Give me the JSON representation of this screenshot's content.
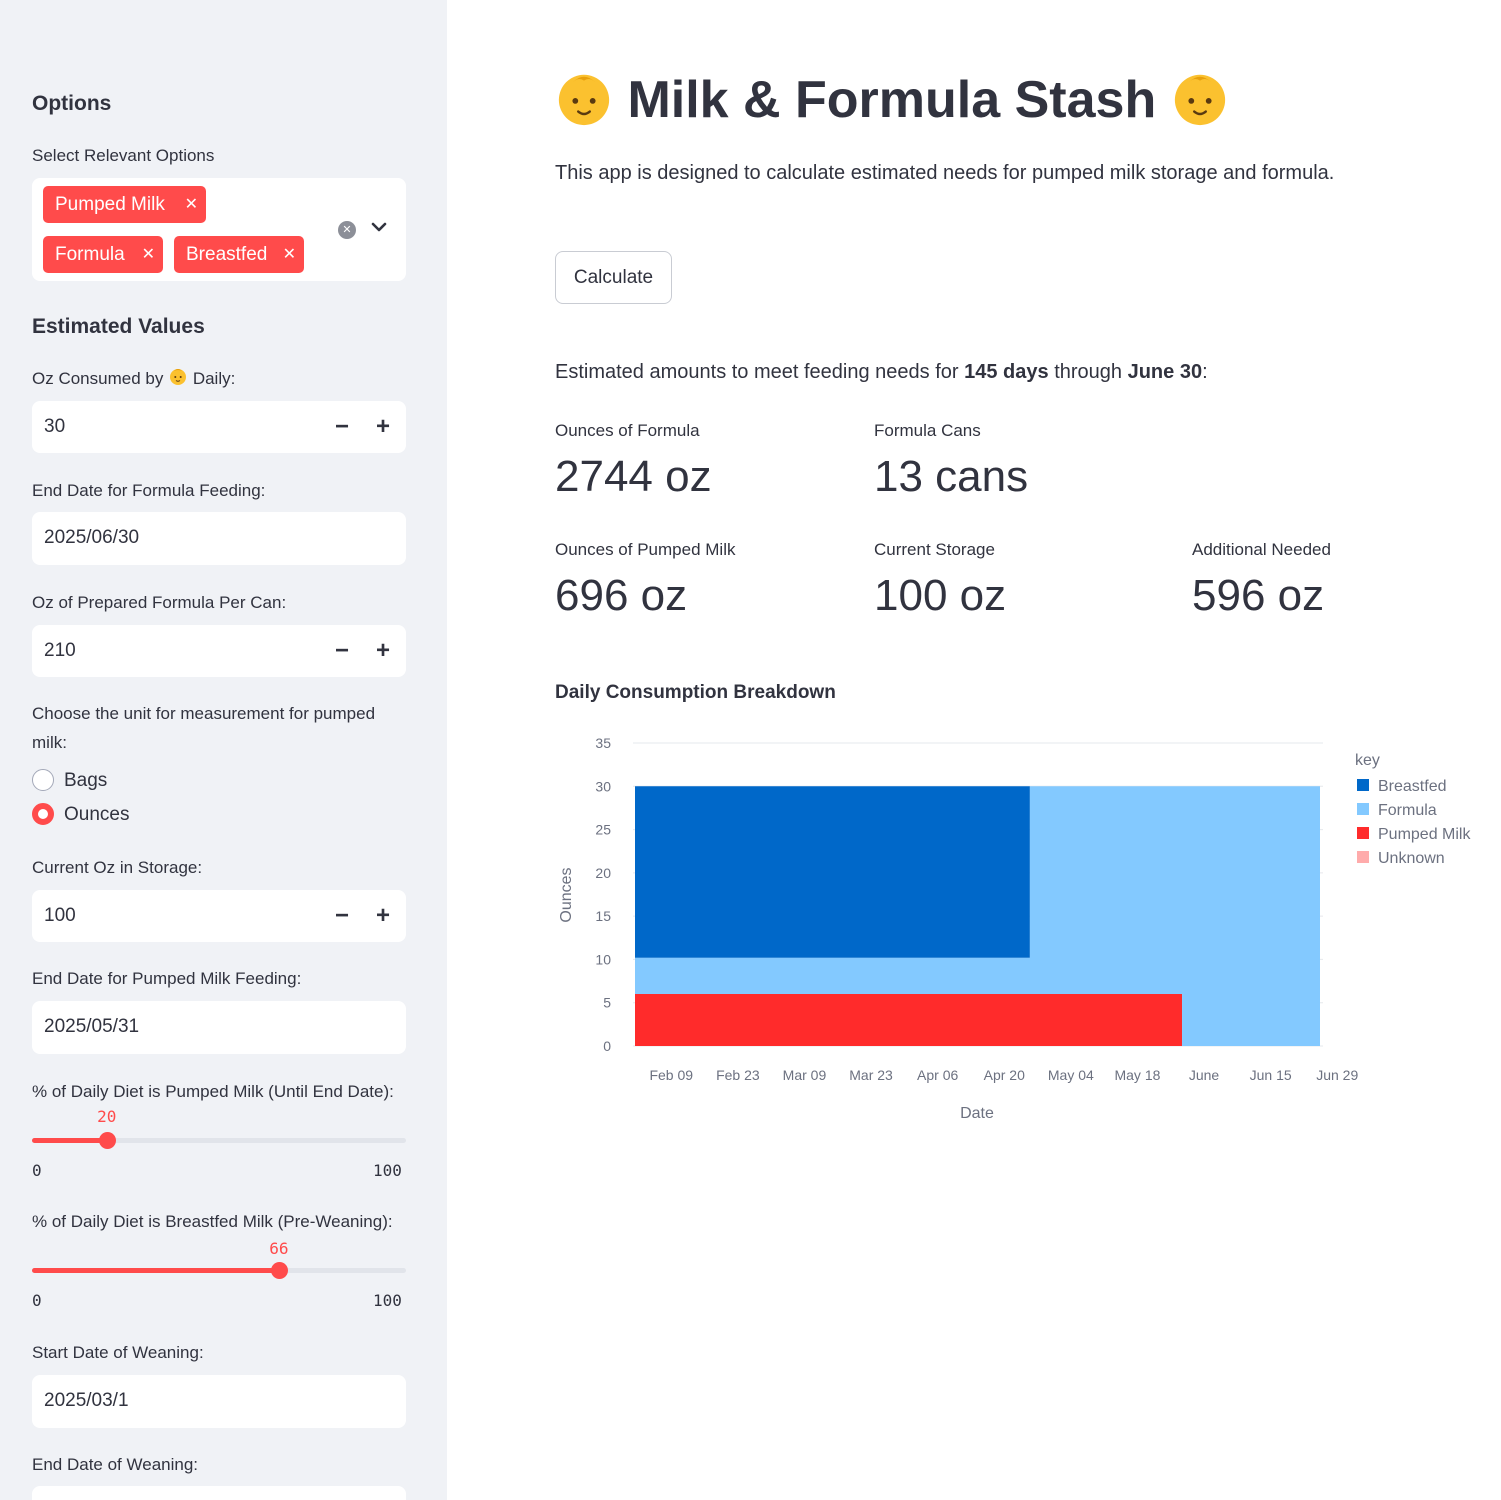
{
  "sidebar": {
    "options_heading": "Options",
    "select_label": "Select Relevant Options",
    "selected_options": [
      "Pumped Milk",
      "Formula",
      "Breastfed"
    ],
    "estimated_heading": "Estimated Values",
    "oz_consumed_label_pre": "Oz Consumed by",
    "oz_consumed_label_post": "Daily:",
    "oz_consumed_value": "30",
    "formula_end_label": "End Date for Formula Feeding:",
    "formula_end_value": "2025/06/30",
    "oz_per_can_label": "Oz of Prepared Formula Per Can:",
    "oz_per_can_value": "210",
    "unit_label": "Choose the unit for measurement for pumped milk:",
    "unit_options": [
      "Bags",
      "Ounces"
    ],
    "unit_selected": "Ounces",
    "current_storage_label": "Current Oz in Storage:",
    "current_storage_value": "100",
    "pumped_end_label": "End Date for Pumped Milk Feeding:",
    "pumped_end_value": "2025/05/31",
    "pumped_pct_label": "% of Daily Diet is Pumped Milk (Until End Date):",
    "pumped_pct_value": 20,
    "breastfed_pct_label": "% of Daily Diet is Breastfed Milk (Pre-Weaning):",
    "breastfed_pct_value": 66,
    "slider_min": "0",
    "slider_max": "100",
    "weaning_start_label": "Start Date of Weaning:",
    "weaning_start_value": "2025/03/1",
    "weaning_end_label": "End Date of Weaning:"
  },
  "main": {
    "title": "Milk & Formula Stash",
    "title_icon": "baby-emoji",
    "intro": "This app is designed to calculate estimated needs for pumped milk storage and formula.",
    "calculate_button": "Calculate",
    "estimate_pre": "Estimated amounts to meet feeding needs for ",
    "estimate_days": "145 days",
    "estimate_mid": " through ",
    "estimate_date": "June 30",
    "estimate_post": ":",
    "metrics": {
      "formula_oz": {
        "label": "Ounces of Formula",
        "value": "2744 oz"
      },
      "formula_cans": {
        "label": "Formula Cans",
        "value": "13 cans"
      },
      "pumped_oz": {
        "label": "Ounces of Pumped Milk",
        "value": "696 oz"
      },
      "current_storage": {
        "label": "Current Storage",
        "value": "100 oz"
      },
      "additional_needed": {
        "label": "Additional Needed",
        "value": "596 oz"
      }
    },
    "chart_title": "Daily Consumption Breakdown"
  },
  "colors": {
    "accent": "#ff4b4b",
    "sidebar_bg": "#f0f2f6",
    "breastfed": "#0068c9",
    "formula": "#83c9ff",
    "pumped_milk": "#ff2b2b",
    "unknown": "#ffabab"
  },
  "chart_data": {
    "type": "area",
    "stacked": true,
    "xlabel": "Date",
    "ylabel": "Ounces",
    "ylim": [
      0,
      35
    ],
    "yticks": [
      0,
      5,
      10,
      15,
      20,
      25,
      30,
      35
    ],
    "xlim": [
      "2025-02-06",
      "2025-06-30"
    ],
    "x_tick_labels": [
      "Feb 09",
      "Feb 23",
      "Mar 09",
      "Mar 23",
      "Apr 06",
      "Apr 20",
      "May 04",
      "May 18",
      "June",
      "Jun 15",
      "Jun 29"
    ],
    "x_tick_dates": [
      "2025-02-09",
      "2025-02-23",
      "2025-03-09",
      "2025-03-23",
      "2025-04-06",
      "2025-04-20",
      "2025-05-04",
      "2025-05-18",
      "2025-06-01",
      "2025-06-15",
      "2025-06-29"
    ],
    "legend_title": "key",
    "legend_position": "right",
    "grid": "horizontal",
    "x": [
      "2025-02-06",
      "2025-03-01",
      "2025-04-30",
      "2025-05-31",
      "2025-06-01",
      "2025-06-30"
    ],
    "series": [
      {
        "name": "Pumped Milk",
        "values": [
          6,
          6,
          6,
          6,
          0,
          0
        ]
      },
      {
        "name": "Formula",
        "values": [
          4.2,
          4.2,
          24,
          24,
          30,
          30
        ]
      },
      {
        "name": "Breastfed",
        "values": [
          19.8,
          19.8,
          0,
          0,
          0,
          0
        ]
      },
      {
        "name": "Unknown",
        "values": [
          0,
          0,
          0,
          0,
          0,
          0
        ]
      }
    ]
  }
}
